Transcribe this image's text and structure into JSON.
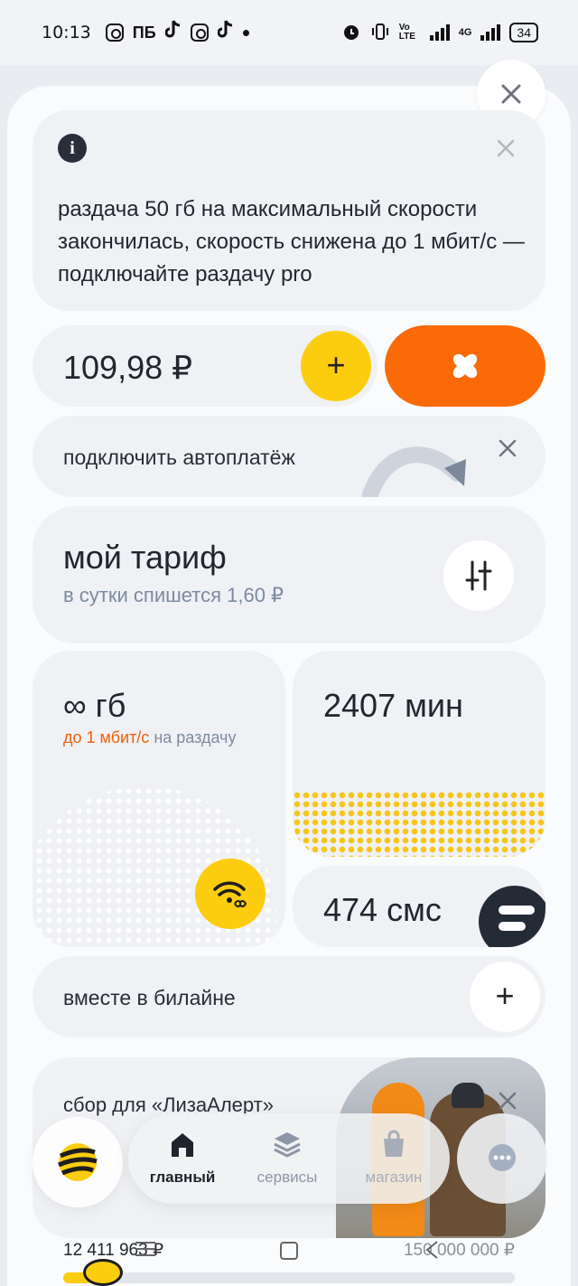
{
  "status_bar": {
    "time": "10:13",
    "app_icons": [
      "instagram-icon",
      "pb-icon",
      "tiktok-icon",
      "instagram-icon",
      "tiktok-icon"
    ],
    "pb_text": "ПБ",
    "network": "4G",
    "volte": "Vo LTE",
    "battery": "34"
  },
  "info_card": {
    "text": "раздача 50 гб на максимальный скорости закончилась, скорость снижена до 1 мбит/с — подключайте раздачу pro"
  },
  "balance": {
    "amount": "109,98 ₽",
    "topup_symbol": "+"
  },
  "autopay": {
    "label": "подключить автоплатёж"
  },
  "tariff": {
    "title": "мой тариф",
    "subtitle": "в сутки спишется 1,60 ₽"
  },
  "traffic": {
    "title": "∞ гб",
    "speed": "до 1 мбит/с",
    "note": " на раздачу"
  },
  "minutes": {
    "title": "2407 мин"
  },
  "sms": {
    "title": "474 смс"
  },
  "together": {
    "label": "вместе в билайне",
    "add_symbol": "+"
  },
  "promo": {
    "title": "сбор для «ЛизаАлерт»"
  },
  "fundraise": {
    "collected": "12 411 963 ₽",
    "goal": "150 000 000 ₽",
    "progress_fraction": 0.083
  },
  "nav": {
    "home": "главный",
    "services": "сервисы",
    "shop": "магазин"
  },
  "colors": {
    "brand_yellow": "#fbcd0e",
    "accent_orange": "#fa6a07",
    "text_dark": "#23262f",
    "text_muted": "#7c8aa0"
  }
}
